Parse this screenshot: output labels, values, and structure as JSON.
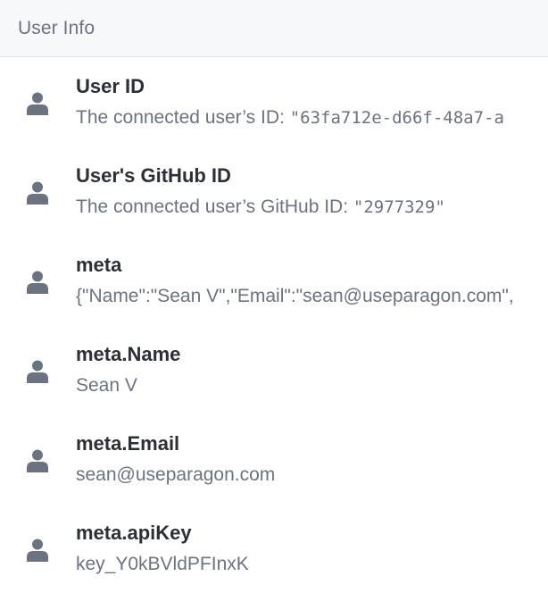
{
  "header": {
    "title": "User Info"
  },
  "colors": {
    "header_bg": "#f7f8fa",
    "icon": "#6b7280",
    "name_text": "#2b2f36",
    "desc_text": "#6b7280"
  },
  "items": [
    {
      "icon": "user-icon",
      "name": "User ID",
      "desc_prefix": "The connected user’s ID: ",
      "desc_mono": "\"63fa712e-d66f-48a7-a"
    },
    {
      "icon": "user-icon",
      "name": "User's GitHub ID",
      "desc_prefix": "The connected user’s GitHub ID: ",
      "desc_mono": "\"2977329\""
    },
    {
      "icon": "user-icon",
      "name": "meta",
      "desc": "{\"Name\":\"Sean V\",\"Email\":\"sean@useparagon.com\","
    },
    {
      "icon": "user-icon",
      "name": "meta.Name",
      "desc": "Sean V"
    },
    {
      "icon": "user-icon",
      "name": "meta.Email",
      "desc": "sean@useparagon.com"
    },
    {
      "icon": "user-icon",
      "name": "meta.apiKey",
      "desc": "key_Y0kBVldPFInxK"
    }
  ]
}
